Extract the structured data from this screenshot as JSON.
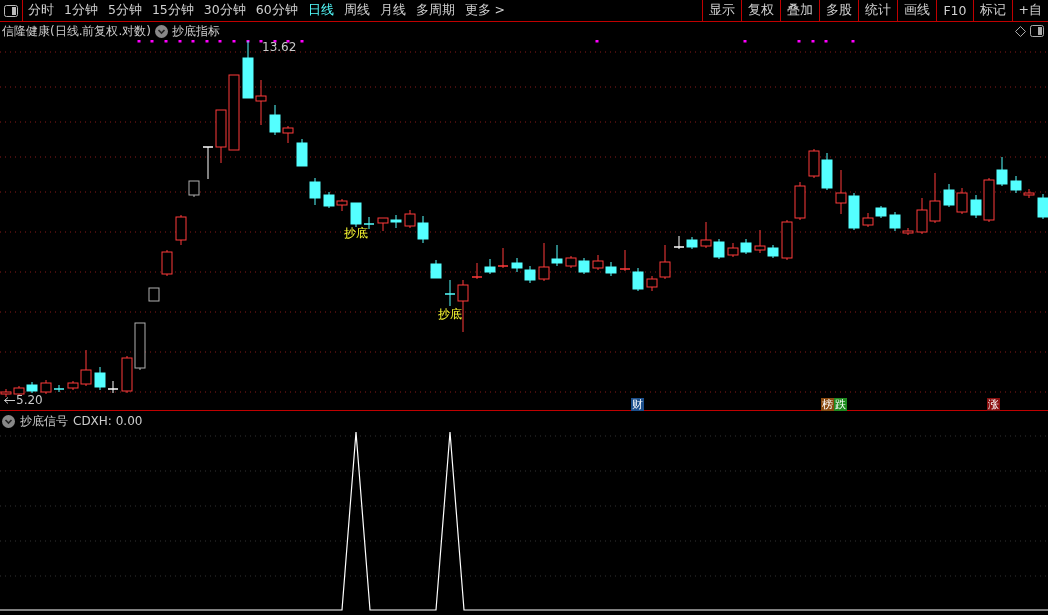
{
  "toolbar": {
    "periods": [
      {
        "label": "分时",
        "selected": false
      },
      {
        "label": "1分钟",
        "selected": false
      },
      {
        "label": "5分钟",
        "selected": false
      },
      {
        "label": "15分钟",
        "selected": false
      },
      {
        "label": "30分钟",
        "selected": false
      },
      {
        "label": "60分钟",
        "selected": false
      },
      {
        "label": "日线",
        "selected": true
      },
      {
        "label": "周线",
        "selected": false
      },
      {
        "label": "月线",
        "selected": false
      },
      {
        "label": "多周期",
        "selected": false
      },
      {
        "label": "更多 >",
        "selected": false
      }
    ],
    "tools": [
      "显示",
      "复权",
      "叠加",
      "多股",
      "统计",
      "画线",
      "F10",
      "标记",
      "+自"
    ]
  },
  "main_chart": {
    "title": "信隆健康(日线.前复权.对数)",
    "indicator": "抄底指标",
    "high_label": "13.62",
    "low_label": "5.20",
    "signals": [
      "抄底",
      "抄底"
    ],
    "badges": [
      {
        "text": "财",
        "color": "#1c4f8c"
      },
      {
        "text": "榜",
        "color": "#8a4a10"
      },
      {
        "text": "跌",
        "color": "#1f8a1f"
      },
      {
        "text": "涨",
        "color": "#8a1010"
      }
    ]
  },
  "sub_chart": {
    "name": "抄底信号",
    "reading": "CDXH: 0.00"
  }
}
